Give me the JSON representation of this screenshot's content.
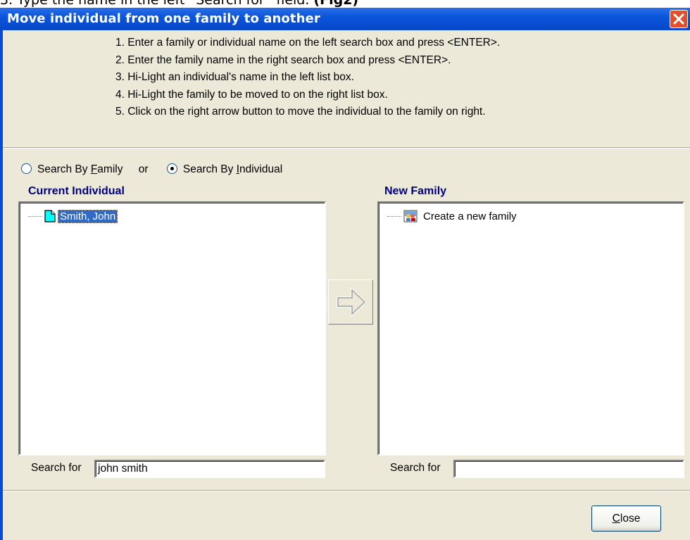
{
  "document": {
    "line_text": "3.  Type the name in the left “Search for” field.",
    "line_bold": "(Fig2)"
  },
  "dialog": {
    "title": "Move individual from one family to another",
    "instructions": [
      "1. Enter a family or individual name on the left search box and press <ENTER>.",
      "2. Enter the family name in the right search box and press <ENTER>.",
      "3. Hi-Light an individual's name in the left list box.",
      "4. Hi-Light the family to be moved to on the right list box.",
      "5. Click on the right arrow button to move  the individual to the family on right."
    ],
    "search_mode": {
      "option_family": "Search By Family",
      "option_family_access": "F",
      "or_text": "or",
      "option_individual": "Search By Individual",
      "option_individual_access": "I",
      "selected": "individual"
    },
    "left_panel": {
      "label": "Current Individual",
      "items": [
        {
          "label": "Smith, John",
          "icon": "document-icon",
          "selected": true
        }
      ],
      "search_label": "Search for",
      "search_value": "john smith"
    },
    "right_panel": {
      "label": "New Family",
      "items": [
        {
          "label": "Create a new family",
          "icon": "family-icon",
          "selected": false
        }
      ],
      "search_label": "Search for",
      "search_value": ""
    },
    "move_button_icon": "right-arrow-icon",
    "close_button": {
      "label": "Close",
      "access_key": "C"
    }
  },
  "colors": {
    "titlebar": "#0a55dc",
    "dialog_bg": "#ece9d8",
    "label_blue": "#000080",
    "selection": "#316ac5",
    "close_icon_bg": "#e2512c"
  }
}
